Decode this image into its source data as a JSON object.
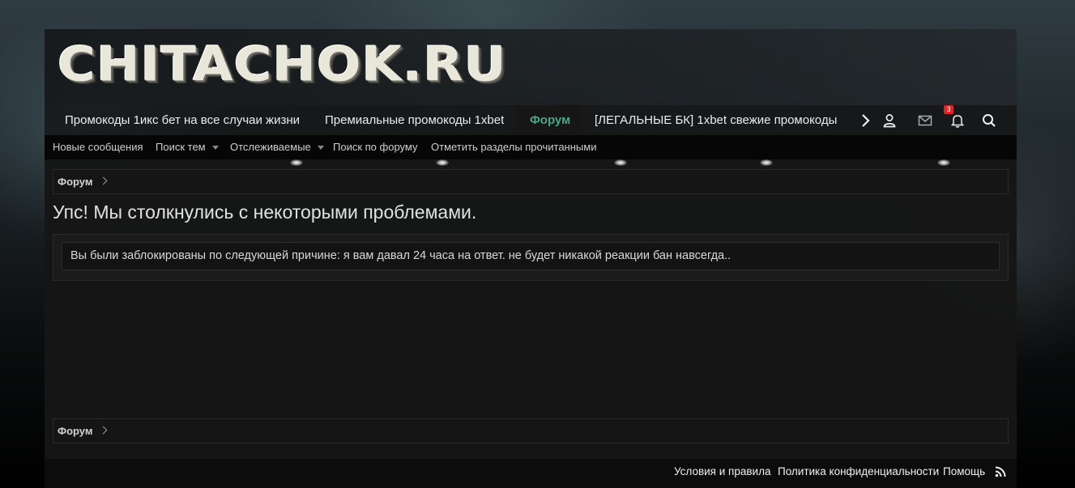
{
  "header": {
    "logo_text": "CHITACHOK.RU"
  },
  "nav": {
    "items": [
      {
        "label": "Промокоды 1икс бет на все случаи жизни"
      },
      {
        "label": "Премиальные промокоды 1xbet"
      },
      {
        "label": "Форум",
        "active": true
      },
      {
        "label": "[ЛЕГАЛЬНЫЕ БК] 1xbet свежие промокоды"
      }
    ],
    "icons": [
      "chevron-right-icon",
      "user-icon",
      "envelope-icon",
      "bell-icon",
      "search-icon"
    ],
    "alerts_count": "3",
    "accent_color": "#4fa38a"
  },
  "subnav": {
    "items": [
      {
        "label": "Новые сообщения"
      },
      {
        "label": "Поиск тем",
        "has_dropdown": true
      },
      {
        "label": "Отслеживаемые",
        "has_dropdown": true
      },
      {
        "label": "Поиск по форуму"
      },
      {
        "label": "Отметить разделы прочитанными"
      }
    ]
  },
  "breadcrumb": {
    "label": "Форум"
  },
  "main": {
    "title": "Упс! Мы столкнулись с некоторыми проблемами.",
    "message": "Вы были заблокированы по следующей причине: я вам давал 24 часа на ответ. не будет никакой реакции бан навсегда.."
  },
  "footer": {
    "links": [
      {
        "label": "Условия и правила"
      },
      {
        "label": "Политика конфиденциальности"
      },
      {
        "label": "Помощь"
      }
    ],
    "rss_icon": "rss-icon"
  }
}
